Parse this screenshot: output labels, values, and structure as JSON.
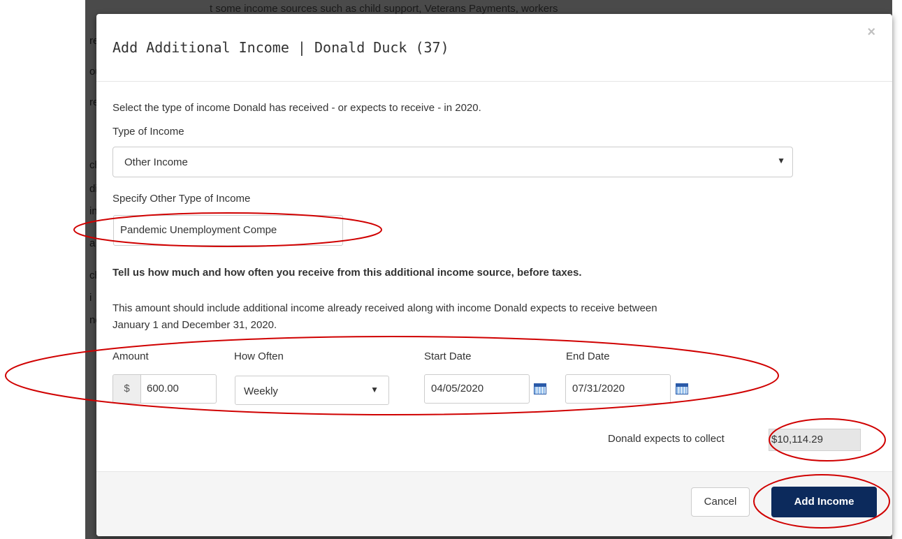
{
  "background": {
    "top_line": "t some income sources such as child support, Veterans Payments, workers",
    "fragments": [
      "re",
      "ou",
      "re",
      "ch",
      "di",
      "in",
      "a",
      "ch",
      "i",
      "ne"
    ]
  },
  "modal": {
    "title": "Add Additional Income | Donald Duck (37)",
    "close_glyph": "×"
  },
  "form": {
    "intro": "Select the type of income Donald has received - or expects to receive - in 2020.",
    "income_type": {
      "label": "Type of Income",
      "selected": "Other Income",
      "arrow": "▼"
    },
    "other_type": {
      "label": "Specify Other Type of Income",
      "value": "Pandemic Unemployment Compe"
    },
    "instruction": "Tell us how much and how often you receive from this additional income source, before taxes.",
    "description_line1": "This amount should include additional income already received along with income Donald expects to receive between",
    "description_line2": "January 1 and December 31, 2020.",
    "amount": {
      "label": "Amount",
      "prefix": "$",
      "value": "600.00"
    },
    "how_often": {
      "label": "How Often",
      "selected": "Weekly",
      "arrow": "▼"
    },
    "start_date": {
      "label": "Start Date",
      "value": "04/05/2020"
    },
    "end_date": {
      "label": "End Date",
      "value": "07/31/2020"
    },
    "collect": {
      "label": "Donald expects to collect",
      "value": "$10,114.29"
    }
  },
  "footer": {
    "cancel_label": "Cancel",
    "add_label": "Add Income"
  },
  "colors": {
    "annotation": "#d00000",
    "primary_button": "#0c2a5c"
  }
}
